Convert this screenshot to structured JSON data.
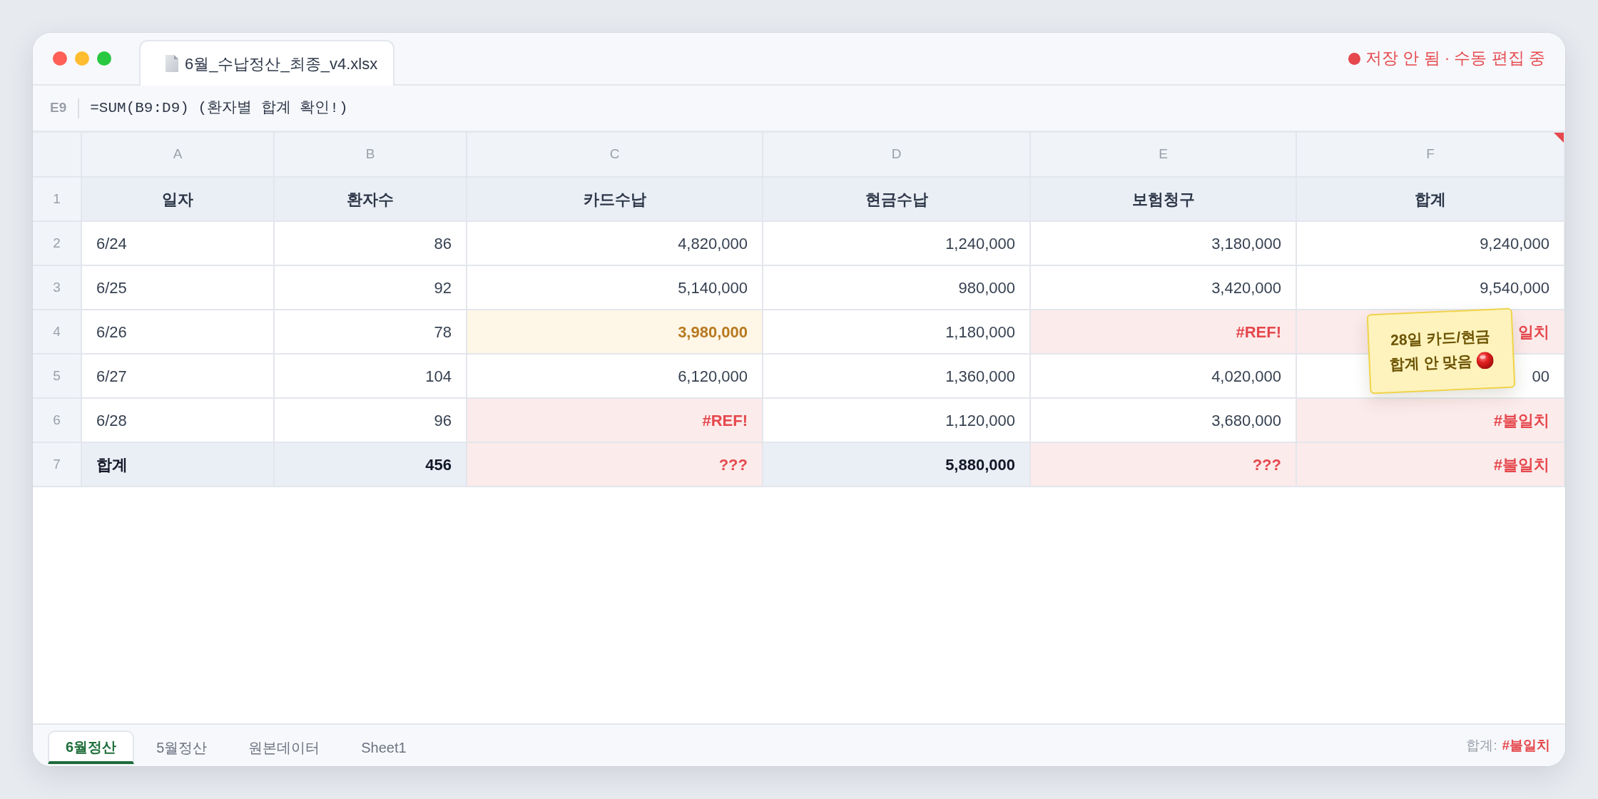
{
  "window": {
    "title": "6월_수납정산_최종_v4.xlsx",
    "save_status": "저장 안 됨 · 수동 편집 중"
  },
  "formula_bar": {
    "cell": "E9",
    "formula": "=SUM(B9:D9) (환자별 합계 확인!)"
  },
  "sheet": {
    "columns": [
      {
        "label": "A",
        "comment": false
      },
      {
        "label": "B",
        "comment": false
      },
      {
        "label": "C",
        "comment": false
      },
      {
        "label": "D",
        "comment": false
      },
      {
        "label": "E",
        "comment": false
      },
      {
        "label": "F",
        "comment": true
      }
    ],
    "rows": [
      {
        "number": "1",
        "kind": "header",
        "cells": [
          {
            "text": "일자",
            "kind": "plain"
          },
          {
            "text": "환자수",
            "kind": "plain"
          },
          {
            "text": "카드수납",
            "kind": "plain"
          },
          {
            "text": "현금수납",
            "kind": "plain"
          },
          {
            "text": "보험청구",
            "kind": "plain"
          },
          {
            "text": "합계",
            "kind": "plain"
          }
        ]
      },
      {
        "number": "2",
        "kind": "data",
        "cells": [
          {
            "text": "6/24",
            "kind": "plain"
          },
          {
            "text": "86",
            "kind": "plain"
          },
          {
            "text": "4,820,000",
            "kind": "plain"
          },
          {
            "text": "1,240,000",
            "kind": "plain"
          },
          {
            "text": "3,180,000",
            "kind": "plain"
          },
          {
            "text": "9,240,000",
            "kind": "plain"
          }
        ]
      },
      {
        "number": "3",
        "kind": "data",
        "cells": [
          {
            "text": "6/25",
            "kind": "plain"
          },
          {
            "text": "92",
            "kind": "plain"
          },
          {
            "text": "5,140,000",
            "kind": "plain"
          },
          {
            "text": "980,000",
            "kind": "plain"
          },
          {
            "text": "3,420,000",
            "kind": "plain"
          },
          {
            "text": "9,540,000",
            "kind": "plain"
          }
        ]
      },
      {
        "number": "4",
        "kind": "data",
        "cells": [
          {
            "text": "6/26",
            "kind": "plain"
          },
          {
            "text": "78",
            "kind": "plain"
          },
          {
            "text": "3,980,000",
            "kind": "warning"
          },
          {
            "text": "1,180,000",
            "kind": "plain"
          },
          {
            "text": "#REF!",
            "kind": "error"
          },
          {
            "text": "일치",
            "kind": "error"
          }
        ]
      },
      {
        "number": "5",
        "kind": "data",
        "cells": [
          {
            "text": "6/27",
            "kind": "plain"
          },
          {
            "text": "104",
            "kind": "plain"
          },
          {
            "text": "6,120,000",
            "kind": "plain"
          },
          {
            "text": "1,360,000",
            "kind": "plain"
          },
          {
            "text": "4,020,000",
            "kind": "plain"
          },
          {
            "text": "00",
            "kind": "plain"
          }
        ]
      },
      {
        "number": "6",
        "kind": "data",
        "cells": [
          {
            "text": "6/28",
            "kind": "plain"
          },
          {
            "text": "96",
            "kind": "plain"
          },
          {
            "text": "#REF!",
            "kind": "error"
          },
          {
            "text": "1,120,000",
            "kind": "plain"
          },
          {
            "text": "3,680,000",
            "kind": "plain"
          },
          {
            "text": "#불일치",
            "kind": "error"
          }
        ]
      },
      {
        "number": "7",
        "kind": "total",
        "cells": [
          {
            "text": "합계",
            "kind": "plain"
          },
          {
            "text": "456",
            "kind": "plain"
          },
          {
            "text": "???",
            "kind": "error"
          },
          {
            "text": "5,880,000",
            "kind": "plain"
          },
          {
            "text": "???",
            "kind": "error"
          },
          {
            "text": "#불일치",
            "kind": "error"
          }
        ]
      }
    ]
  },
  "note": {
    "lines": [
      "28일 카드/현금",
      "합계 안 맞음"
    ]
  },
  "sheet_tabs": [
    {
      "label": "6월정산",
      "selected": true
    },
    {
      "label": "5월정산",
      "selected": false
    },
    {
      "label": "원본데이터",
      "selected": false
    },
    {
      "label": "Sheet1",
      "selected": false
    }
  ],
  "status_bar": {
    "label": "합계:",
    "value": "#불일치"
  }
}
